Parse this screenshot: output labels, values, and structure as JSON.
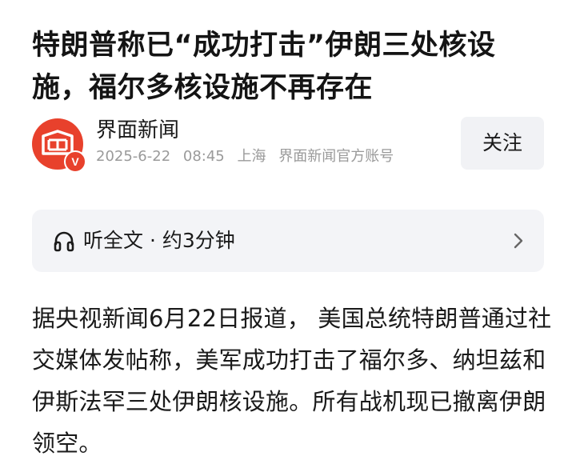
{
  "article": {
    "title": "特朗普称已“成功打击”伊朗三处核设施，福尔多核设施不再存在",
    "author": {
      "name": "界面新闻",
      "date": "2025-6-22",
      "time": "08:45",
      "location": "上海",
      "account_type": "界面新闻官方账号",
      "verified_badge": "V",
      "avatar_icon": "jiemian-logo-icon"
    },
    "follow_label": "关注",
    "listen": {
      "label": "听全文",
      "separator": "·",
      "duration": "约3分钟",
      "icon": "headphones-icon"
    },
    "body": "据央视新闻6月22日报道， 美国总统特朗普通过社交媒体发帖称，美军成功打击了福尔多、纳坦兹和伊斯法罕三处伊朗核设施。所有战机现已撤离伊朗领空。"
  },
  "colors": {
    "brand": "#e8412c",
    "meta_gray": "#9a9a9a",
    "panel_bg": "#f3f4f7"
  }
}
